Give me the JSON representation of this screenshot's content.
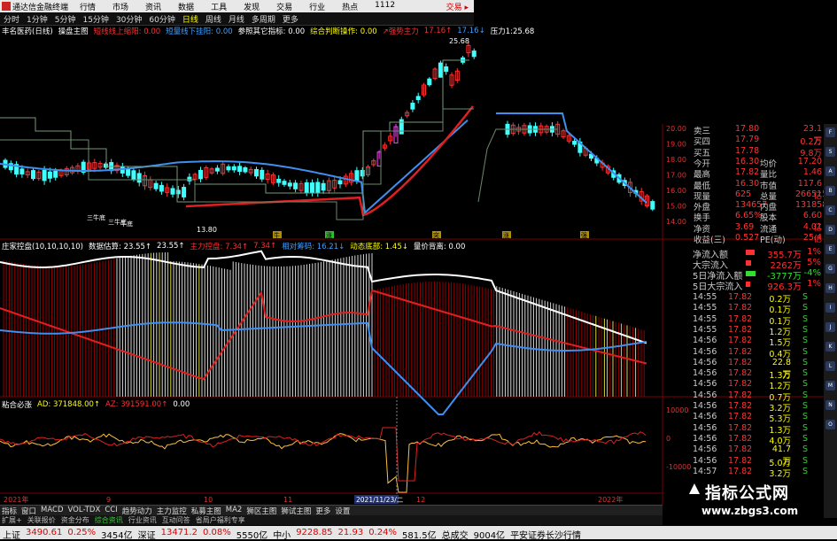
{
  "window": {
    "app_title": "通达信金融终端",
    "menus": [
      "行情",
      "市场",
      "资讯",
      "数据",
      "工具",
      "发现",
      "交易",
      "行业",
      "热点",
      "1112"
    ],
    "trade_label": "交易 ▸"
  },
  "periods": {
    "items": [
      "分时",
      "1分钟",
      "5分钟",
      "15分钟",
      "30分钟",
      "60分钟",
      "日线",
      "周线",
      "月线",
      "多周期",
      "更多"
    ],
    "active": "日线"
  },
  "main_indicator": {
    "stock_name": "丰名医药(日线)",
    "name": "操盘主图",
    "params": [
      {
        "text": "短线线上缩阳: 0.00",
        "color": "#ff3030"
      },
      {
        "text": "短量线下挂阳: 0.00",
        "color": "#3fa0ff"
      },
      {
        "text": "参照其它指标: 0.00",
        "color": "#ffffff"
      },
      {
        "text": "综合判断操作: 0.00",
        "color": "#ffff00"
      },
      {
        "text": "↗强势主力",
        "color": "#ff3030"
      },
      {
        "text": "17.16↑",
        "color": "#ff3030"
      },
      {
        "text": "17.16↓",
        "color": "#3fa0ff"
      },
      {
        "text": "压力1:25.68",
        "color": "#ffffff"
      }
    ],
    "price_labels": {
      "high": "25.68",
      "low": "13.80"
    },
    "annotations": [
      "三牛底",
      "三牛底",
      "牛底"
    ],
    "signal_labels": [
      "牛",
      "涨",
      "突",
      "涨",
      "强"
    ]
  },
  "mid_indicator": {
    "name": "庄家控盘(10,10,10,10)",
    "params": [
      {
        "text": "数据估算: 23.55↑",
        "color": "#ffffff"
      },
      {
        "text": "23.55↑",
        "color": "#ffffff"
      },
      {
        "text": "主力控盘: 7.34↑",
        "color": "#ff3030"
      },
      {
        "text": "7.34↑",
        "color": "#ff3030"
      },
      {
        "text": "相对筹码: 16.21↓",
        "color": "#3fa0ff"
      },
      {
        "text": "动态底部: 1.45↓",
        "color": "#ffff00"
      },
      {
        "text": "量价背离: 0.00",
        "color": "#ffffff"
      }
    ]
  },
  "low_indicator": {
    "name": "粘合必涨",
    "params": [
      {
        "text": "AD: 371848.00↑",
        "color": "#ffff00"
      },
      {
        "text": "AZ: 391591.00↑",
        "color": "#ff3030"
      },
      {
        "text": "0.00",
        "color": "#ffffff"
      }
    ],
    "axis_labels": [
      "10000",
      "0",
      "-10000"
    ]
  },
  "date_axis": {
    "labels": [
      "2021年",
      "9",
      "10",
      "11",
      "12",
      "2022年"
    ],
    "cursor_date": "2021/11/23/二"
  },
  "price_axis": [
    "20.00",
    "19.00",
    "18.00",
    "17.00",
    "16.00",
    "15.00",
    "14.00"
  ],
  "quote": {
    "rows": [
      {
        "label": "卖三",
        "value": "17.80",
        "label2": "",
        "value2": "23.1万"
      },
      {
        "label": "买四",
        "value": "17.79",
        "label2": "",
        "value2": "0.2万"
      },
      {
        "label": "买五",
        "value": "17.78",
        "label2": "",
        "value2": "9.8万"
      },
      {
        "label": "今开",
        "value": "16.30",
        "label2": "均价",
        "value2": "17.20"
      },
      {
        "label": "最高",
        "value": "17.82",
        "label2": "量比",
        "value2": "1.46"
      },
      {
        "label": "最低",
        "value": "16.30",
        "label2": "市值",
        "value2": "117.6亿"
      },
      {
        "label": "现量",
        "value": "625",
        "label2": "总量",
        "value2": "266515"
      },
      {
        "label": "外盘",
        "value": "134657",
        "label2": "内盘",
        "value2": "131858"
      },
      {
        "label": "换手",
        "value": "6.65%",
        "label2": "股本",
        "value2": "6.60亿"
      },
      {
        "label": "净资",
        "value": "3.69",
        "label2": "流通",
        "value2": "4.01亿"
      },
      {
        "label": "收益(三)",
        "value": "0.527",
        "label2": "PE(动)",
        "value2": "25.4"
      }
    ]
  },
  "flow": {
    "rows": [
      {
        "label": "净流入额",
        "value": "355.7万",
        "color": "#ff3030",
        "fill": 0.55
      },
      {
        "label": "大宗流入",
        "value": "2262万",
        "color": "#ff3030",
        "fill": 0.35
      },
      {
        "label": "5日净流入额",
        "value": "-3777万",
        "color": "#33dd33",
        "fill": 0.6
      },
      {
        "label": "5日大宗流入",
        "value": "926.3万",
        "color": "#ff3030",
        "fill": 0.25
      }
    ],
    "percents": [
      "1%",
      "5%",
      "-4%",
      "1%"
    ]
  },
  "ticks": [
    {
      "t": "14:55",
      "p": "17.82",
      "q": "0.2万",
      "s": "S"
    },
    {
      "t": "14:55",
      "p": "17.82",
      "q": "0.1万",
      "s": "S"
    },
    {
      "t": "14:55",
      "p": "17.82",
      "q": "0.1万",
      "s": "S"
    },
    {
      "t": "14:55",
      "p": "17.82",
      "q": "1.2万",
      "s": "S"
    },
    {
      "t": "14:56",
      "p": "17.82",
      "q": "1.5万",
      "s": "S"
    },
    {
      "t": "14:56",
      "p": "17.82",
      "q": "0.4万",
      "s": "S"
    },
    {
      "t": "14:56",
      "p": "17.82",
      "q": "22.8万",
      "s": "S"
    },
    {
      "t": "14:56",
      "p": "17.82",
      "q": "1.3万",
      "s": "S"
    },
    {
      "t": "14:56",
      "p": "17.82",
      "q": "1.2万",
      "s": "S"
    },
    {
      "t": "14:56",
      "p": "17.82",
      "q": "0.7万",
      "s": "S"
    },
    {
      "t": "14:56",
      "p": "17.82",
      "q": "3.2万",
      "s": "S"
    },
    {
      "t": "14:56",
      "p": "17.82",
      "q": "5.3万",
      "s": "S"
    },
    {
      "t": "14:56",
      "p": "17.82",
      "q": "1.3万",
      "s": "S"
    },
    {
      "t": "14:56",
      "p": "17.82",
      "q": "4.0万",
      "s": "S"
    },
    {
      "t": "14:56",
      "p": "17.82",
      "q": "41.7万",
      "s": "S"
    },
    {
      "t": "14:56",
      "p": "17.82",
      "q": "5.0万",
      "s": "S"
    },
    {
      "t": "14:57",
      "p": "17.82",
      "q": "3.2万",
      "s": "S"
    }
  ],
  "tabs": [
    "指标",
    "窗口",
    "MACD",
    "VOL-TDX",
    "CCI",
    "趋势动力",
    "主力监控",
    "私募主图",
    "MA2",
    "狮区主图",
    "狮试主图",
    "更多",
    "设置"
  ],
  "tabs2": [
    "扩展+",
    "关联报价",
    "资金分布",
    "综合资讯",
    "行业资讯",
    "互动问答",
    "省局户福利专享"
  ],
  "tabs2_highlight": "综合资讯",
  "status": [
    {
      "text": "上证",
      "color": "#000"
    },
    {
      "text": "3490.61",
      "color": "#d00"
    },
    {
      "text": "0.25%",
      "color": "#d00"
    },
    {
      "text": "3454亿",
      "color": "#000"
    },
    {
      "text": "深证",
      "color": "#000"
    },
    {
      "text": "13471.2",
      "color": "#d00"
    },
    {
      "text": "0.08%",
      "color": "#d00"
    },
    {
      "text": "5550亿",
      "color": "#000"
    },
    {
      "text": "中小",
      "color": "#000"
    },
    {
      "text": "9228.85",
      "color": "#d00"
    },
    {
      "text": "21.93",
      "color": "#d00"
    },
    {
      "text": "0.24%",
      "color": "#d00"
    },
    {
      "text": "581.5亿",
      "color": "#000"
    },
    {
      "text": "总成交",
      "color": "#000"
    },
    {
      "text": "9004亿",
      "color": "#000"
    },
    {
      "text": "平安证券长沙行情",
      "color": "#000"
    }
  ],
  "watermark": {
    "title": "指标公式网",
    "url": "www.zbgs3.com"
  },
  "side_icons": [
    "F",
    "S",
    "A",
    "B",
    "C",
    "D",
    "E",
    "G",
    "H",
    "I",
    "J",
    "K",
    "L",
    "M",
    "N",
    "O"
  ]
}
